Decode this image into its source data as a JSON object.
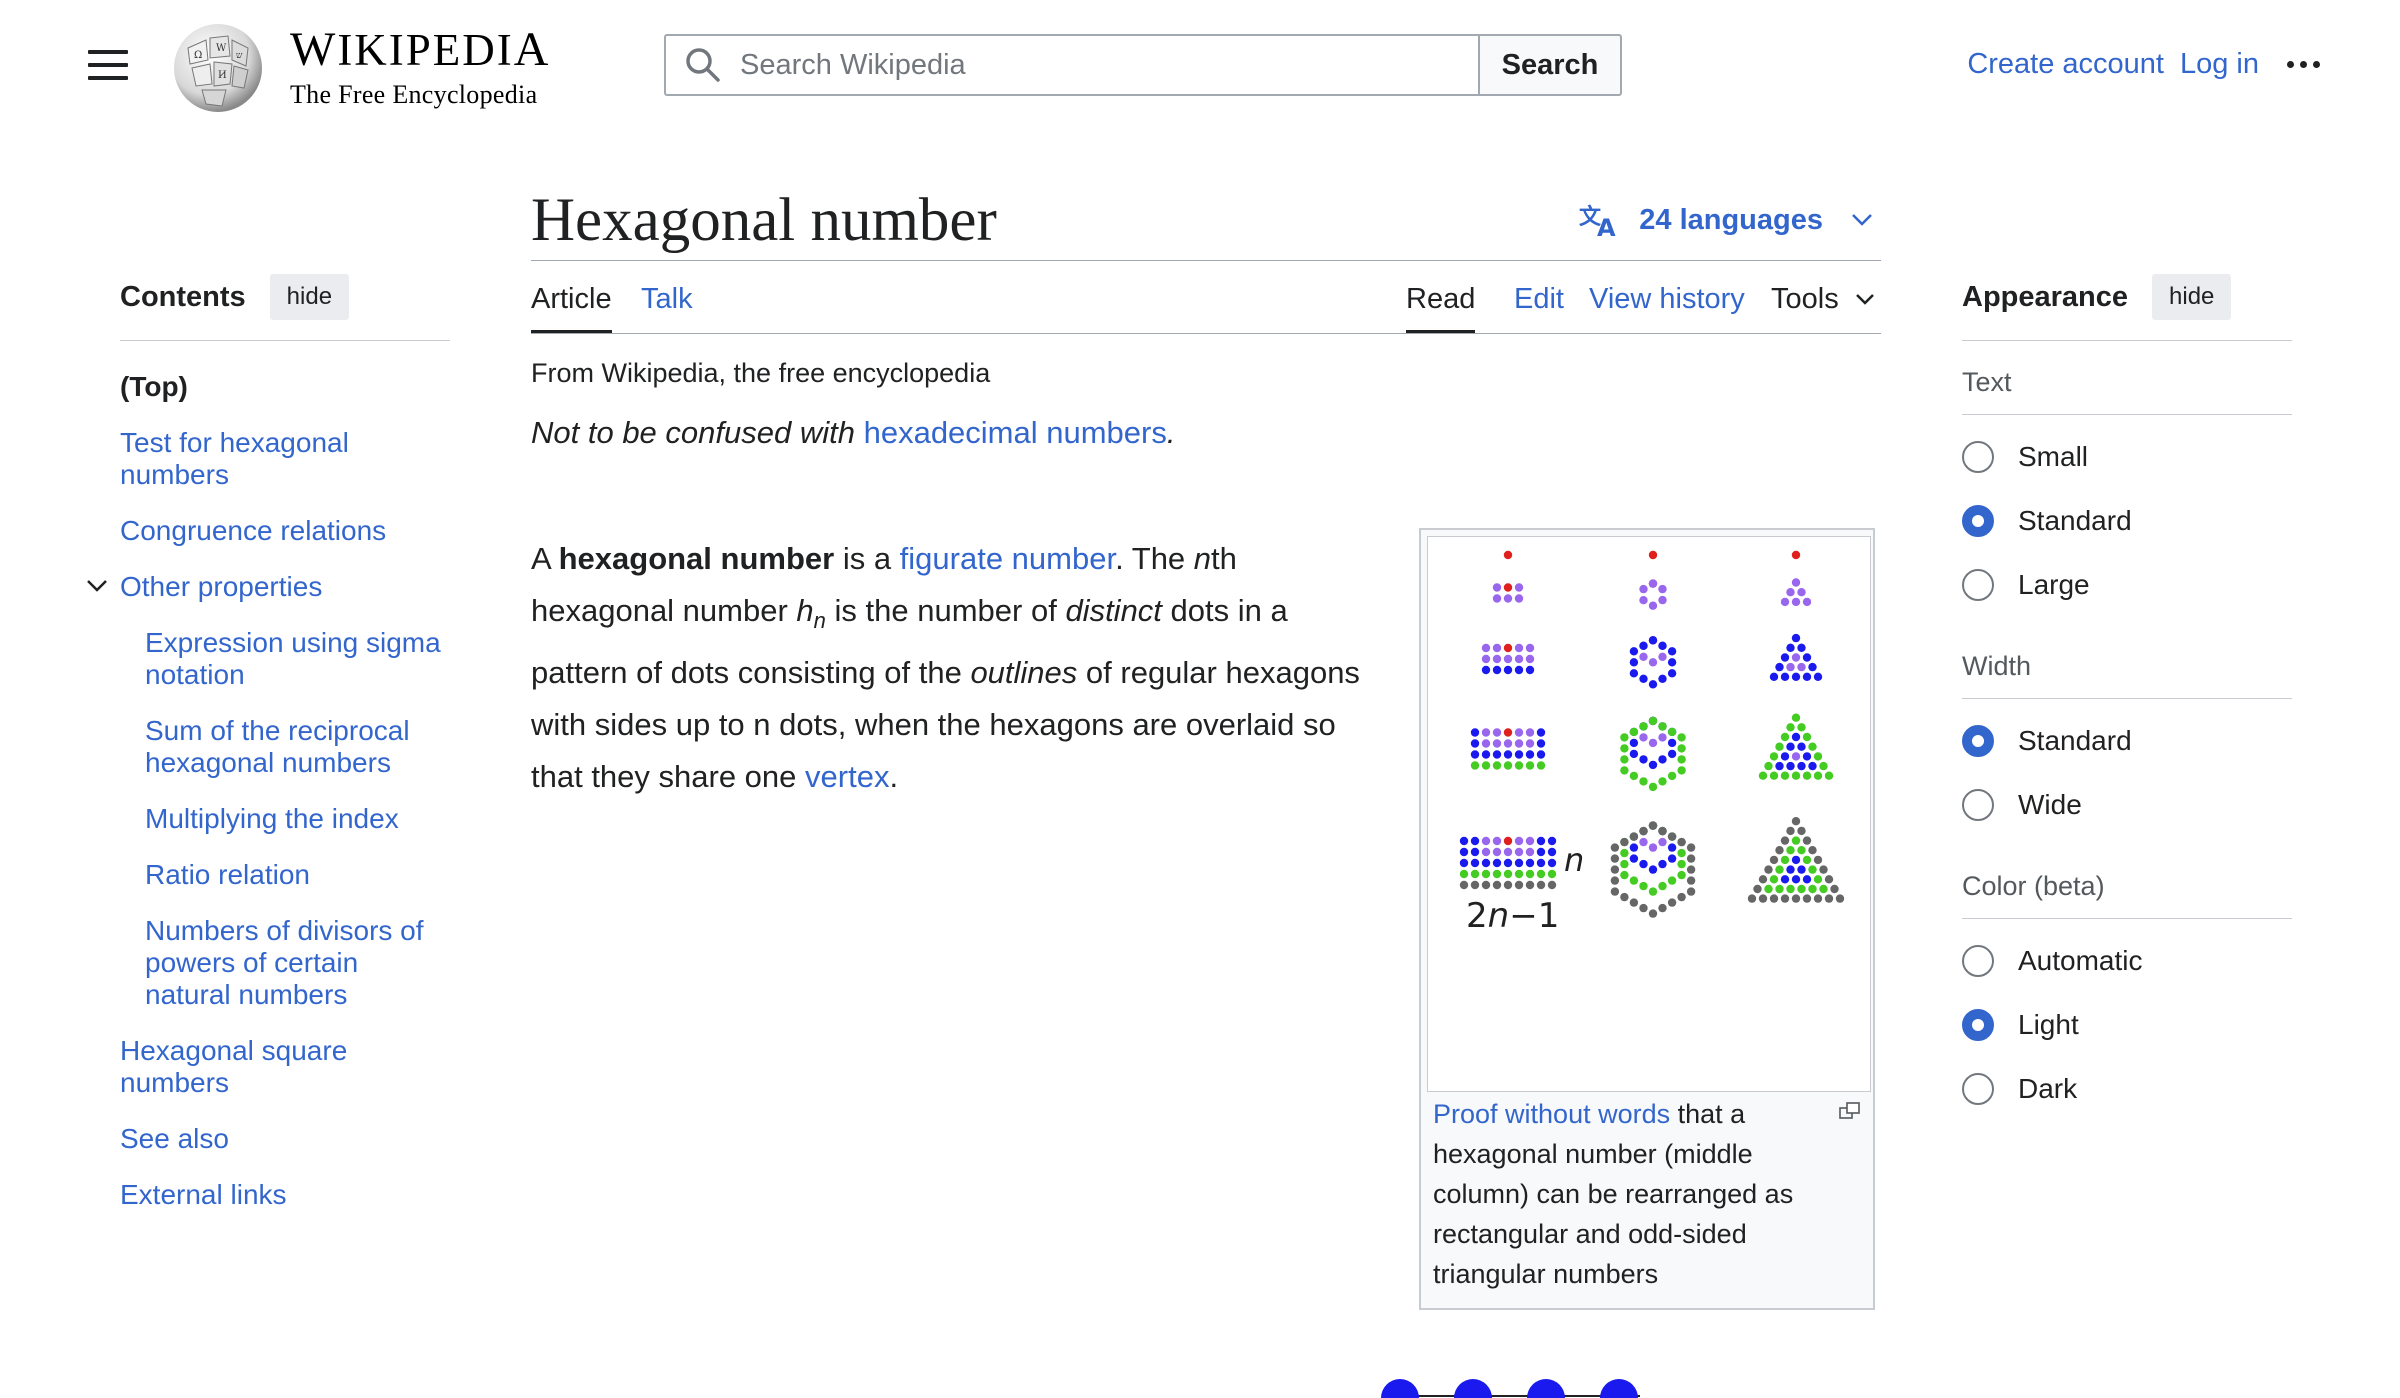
{
  "header": {
    "menu_icon": "hamburger-icon",
    "logo_icon": "wikipedia-globe-icon",
    "wordmark_title_W": "W",
    "wordmark_title_mid": "IKIPEDI",
    "wordmark_title_A": "A",
    "tagline": "The Free Encyclopedia",
    "search_placeholder": "Search Wikipedia",
    "search_button": "Search",
    "create_account": "Create account",
    "log_in": "Log in",
    "more_icon": "ellipsis-icon"
  },
  "toc": {
    "title": "Contents",
    "hide": "hide",
    "items": [
      {
        "label": "(Top)"
      },
      {
        "label": "Test for hexagonal numbers"
      },
      {
        "label": "Congruence relations"
      },
      {
        "label": "Other properties"
      },
      {
        "label": "Expression using sigma notation"
      },
      {
        "label": "Sum of the reciprocal hexagonal numbers"
      },
      {
        "label": "Multiplying the index"
      },
      {
        "label": "Ratio relation"
      },
      {
        "label": "Numbers of divisors of powers of certain natural numbers"
      },
      {
        "label": "Hexagonal square numbers"
      },
      {
        "label": "See also"
      },
      {
        "label": "External links"
      }
    ]
  },
  "article": {
    "title": "Hexagonal number",
    "languages": "24 languages",
    "tabs": {
      "article": "Article",
      "talk": "Talk",
      "read": "Read",
      "edit": "Edit",
      "history": "View history",
      "tools": "Tools"
    },
    "from_wp": "From Wikipedia, the free encyclopedia",
    "hatnote_prefix": "Not to be confused with ",
    "hatnote_link": "hexadecimal numbers",
    "hatnote_suffix": ".",
    "lead": {
      "p1": "A ",
      "bold": "hexagonal number",
      "p2": " is a ",
      "link1": "figurate number",
      "p3": ". The ",
      "n": "n",
      "p4": "th hexagonal number ",
      "h": "h",
      "sub": "n",
      "p5": " is the number of ",
      "distinct": "distinct",
      "p6": " dots in a pattern of dots consisting of the ",
      "outlines": "outlines",
      "p7": " of regular hexagons with sides up to n dots, when the hexagons are overlaid so that they share one ",
      "link2": "vertex",
      "p8": "."
    },
    "figure": {
      "label_n": "n",
      "label_2n_prefix": "2",
      "label_2n_n": "n",
      "label_2n_suffix": "−1",
      "caption_link": "Proof without words",
      "caption_text": " that a hexagonal number (middle column) can be rearranged as rectangular and odd-sided triangular numbers",
      "magnify_icon": "enlarge-icon"
    }
  },
  "appearance": {
    "title": "Appearance",
    "hide": "hide",
    "text_label": "Text",
    "text_options": [
      "Small",
      "Standard",
      "Large"
    ],
    "text_selected": "Standard",
    "width_label": "Width",
    "width_options": [
      "Standard",
      "Wide"
    ],
    "width_selected": "Standard",
    "color_label": "Color (beta)",
    "color_options": [
      "Automatic",
      "Light",
      "Dark"
    ],
    "color_selected": "Light"
  },
  "colors": {
    "link": "#3366cc",
    "dot_red": "#e0201c",
    "dot_purple": "#9966ee",
    "dot_blue": "#1a1aee",
    "dot_green": "#44cc22",
    "dot_gray": "#666666",
    "dot_orange": "#f0a030"
  }
}
